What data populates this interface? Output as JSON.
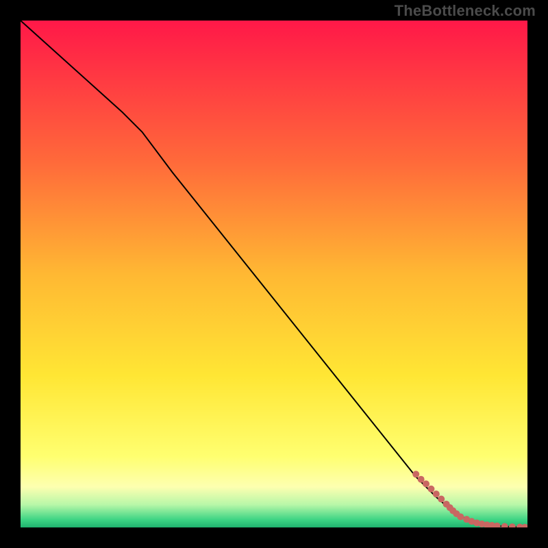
{
  "watermark": "TheBottleneck.com",
  "chart_data": {
    "type": "line",
    "title": "",
    "xlabel": "",
    "ylabel": "",
    "xlim": [
      0,
      100
    ],
    "ylim": [
      0,
      100
    ],
    "grid": false,
    "legend": false,
    "background_gradient": {
      "stops": [
        {
          "pos": 0.0,
          "color": "#FF1848"
        },
        {
          "pos": 0.28,
          "color": "#FF6A3A"
        },
        {
          "pos": 0.5,
          "color": "#FFB833"
        },
        {
          "pos": 0.7,
          "color": "#FFE634"
        },
        {
          "pos": 0.86,
          "color": "#FFFF70"
        },
        {
          "pos": 0.92,
          "color": "#FDFFB0"
        },
        {
          "pos": 0.955,
          "color": "#B8F7A8"
        },
        {
          "pos": 0.985,
          "color": "#3CD484"
        },
        {
          "pos": 1.0,
          "color": "#1FB26E"
        }
      ]
    },
    "series": [
      {
        "name": "curve",
        "color": "#000000",
        "stroke_width": 2,
        "x": [
          0,
          10,
          20,
          24,
          30,
          40,
          50,
          60,
          70,
          78,
          82,
          86,
          90,
          94,
          98,
          100
        ],
        "y": [
          100,
          91,
          82,
          78,
          70,
          57.5,
          45,
          32.5,
          20,
          10,
          6,
          2.5,
          1,
          0.3,
          0.05,
          0.02
        ]
      },
      {
        "name": "scatter",
        "type": "scatter",
        "color": "#C96762",
        "marker": "circle",
        "marker_size": 5,
        "x": [
          78,
          79,
          80,
          81,
          82,
          83,
          84,
          84.7,
          85.3,
          86,
          86.8,
          88,
          89,
          90,
          91,
          92,
          93,
          94,
          95.5,
          97,
          98.5,
          99.5
        ],
        "y": [
          10.5,
          9.5,
          8.6,
          7.6,
          6.6,
          5.6,
          4.6,
          3.9,
          3.3,
          2.7,
          2.1,
          1.6,
          1.2,
          0.9,
          0.7,
          0.5,
          0.4,
          0.3,
          0.2,
          0.12,
          0.06,
          0.03
        ]
      }
    ]
  }
}
